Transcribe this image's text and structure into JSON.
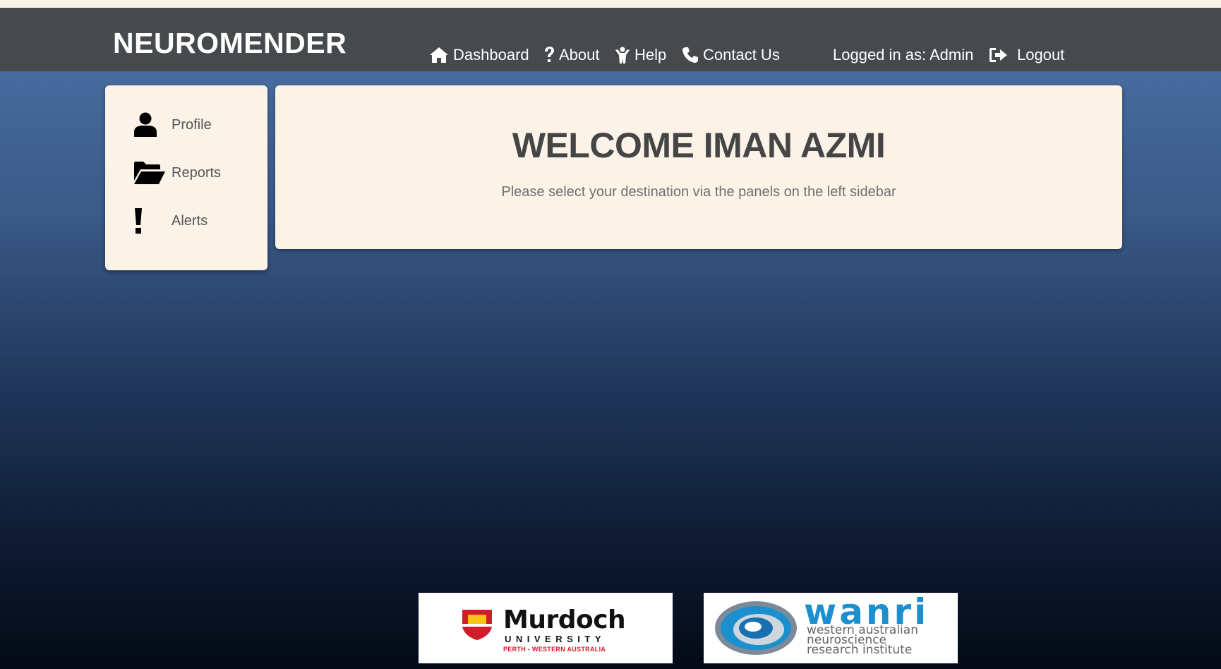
{
  "header": {
    "brand": "NEUROMENDER",
    "nav": [
      {
        "label": "Dashboard",
        "icon": "home-icon"
      },
      {
        "label": "About",
        "icon": "question-icon"
      },
      {
        "label": "Help",
        "icon": "help-person-icon"
      },
      {
        "label": "Contact Us",
        "icon": "phone-icon"
      }
    ],
    "logged_in": "Logged in as: Admin",
    "logout": {
      "label": "Logout",
      "icon": "logout-icon"
    }
  },
  "sidebar": {
    "items": [
      {
        "label": "Profile",
        "icon": "user-icon"
      },
      {
        "label": "Reports",
        "icon": "folder-open-icon"
      },
      {
        "label": "Alerts",
        "icon": "exclamation-icon"
      }
    ]
  },
  "main": {
    "title": "WELCOME IMAN AZMI",
    "subtitle": "Please select your destination via the panels on the left sidebar"
  },
  "footer": {
    "murdoch": {
      "name": "Murdoch",
      "university": "UNIVERSITY",
      "location": "PERTH - WESTERN AUSTRALIA"
    },
    "wanri": {
      "name": "wanri",
      "line1": "western australian",
      "line2": "neuroscience",
      "line3": "research institute"
    }
  },
  "colors": {
    "navbar": "#464a4c",
    "panel": "#fcf3e8",
    "murdoch_red": "#d21c2c",
    "wanri_blue": "#1c8fcf"
  }
}
